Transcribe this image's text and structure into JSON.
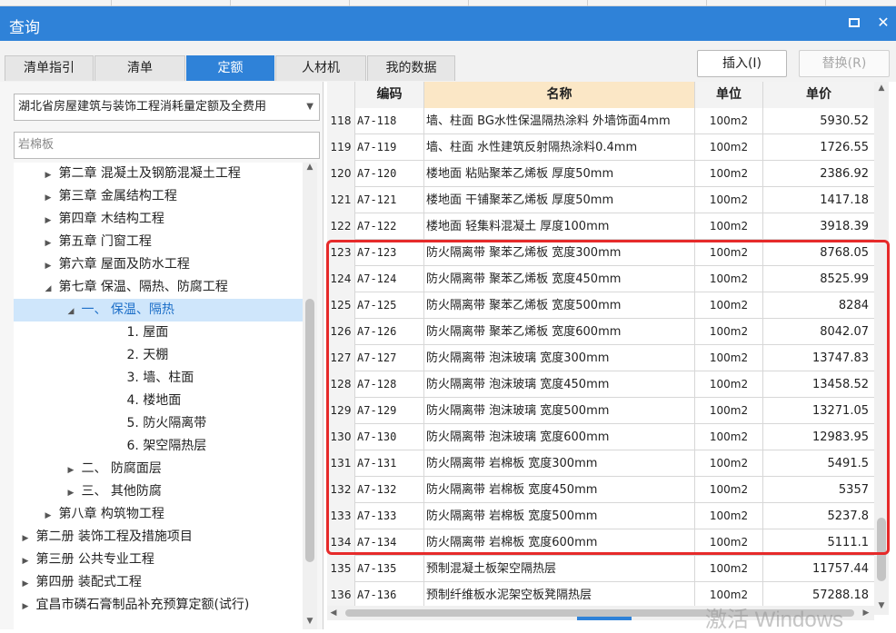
{
  "window": {
    "title": "查询",
    "restore_icon": "restore-icon",
    "close_icon": "close-icon"
  },
  "tabs": [
    {
      "label": "清单指引",
      "active": false
    },
    {
      "label": "清单",
      "active": false
    },
    {
      "label": "定额",
      "active": true
    },
    {
      "label": "人材机",
      "active": false
    },
    {
      "label": "我的数据",
      "active": false
    }
  ],
  "buttons": {
    "insert": "插入(I)",
    "replace": "替换(R)"
  },
  "left": {
    "quota_book": "湖北省房屋建筑与装饰工程消耗量定额及全费用",
    "search_value": "岩棉板",
    "tree": [
      {
        "label": "第二章 混凝土及钢筋混凝土工程",
        "indent": 1,
        "arrow": "▶"
      },
      {
        "label": "第三章 金属结构工程",
        "indent": 1,
        "arrow": "▶"
      },
      {
        "label": "第四章 木结构工程",
        "indent": 1,
        "arrow": "▶"
      },
      {
        "label": "第五章 门窗工程",
        "indent": 1,
        "arrow": "▶"
      },
      {
        "label": "第六章 屋面及防水工程",
        "indent": 1,
        "arrow": "▶"
      },
      {
        "label": "第七章 保温、隔热、防腐工程",
        "indent": 1,
        "arrow": "◢"
      },
      {
        "label": "一、 保温、隔热",
        "indent": 2,
        "arrow": "◢",
        "selected": true
      },
      {
        "label": "1. 屋面",
        "indent": 4,
        "arrow": ""
      },
      {
        "label": "2. 天棚",
        "indent": 4,
        "arrow": ""
      },
      {
        "label": "3. 墙、柱面",
        "indent": 4,
        "arrow": ""
      },
      {
        "label": "4. 楼地面",
        "indent": 4,
        "arrow": ""
      },
      {
        "label": "5. 防火隔离带",
        "indent": 4,
        "arrow": ""
      },
      {
        "label": "6. 架空隔热层",
        "indent": 4,
        "arrow": ""
      },
      {
        "label": "二、 防腐面层",
        "indent": 2,
        "arrow": "▶"
      },
      {
        "label": "三、 其他防腐",
        "indent": 2,
        "arrow": "▶"
      },
      {
        "label": "第八章 构筑物工程",
        "indent": 1,
        "arrow": "▶"
      },
      {
        "label": "第二册 装饰工程及措施项目",
        "indent": 0,
        "arrow": "▶"
      },
      {
        "label": "第三册 公共专业工程",
        "indent": 0,
        "arrow": "▶"
      },
      {
        "label": "第四册 装配式工程",
        "indent": 0,
        "arrow": "▶"
      },
      {
        "label": "宜昌市磷石膏制品补充预算定额(试行)",
        "indent": 0,
        "arrow": "▶"
      }
    ]
  },
  "table": {
    "headers": {
      "code": "编码",
      "name": "名称",
      "unit": "单位",
      "price": "单价"
    },
    "rows": [
      {
        "idx": "118",
        "code": "A7-118",
        "name": "墙、柱面 BG水性保温隔热涂料 外墙饰面4mm",
        "unit": "100m2",
        "price": "5930.52"
      },
      {
        "idx": "119",
        "code": "A7-119",
        "name": "墙、柱面 水性建筑反射隔热涂料0.4mm",
        "unit": "100m2",
        "price": "1726.55"
      },
      {
        "idx": "120",
        "code": "A7-120",
        "name": "楼地面 粘贴聚苯乙烯板 厚度50mm",
        "unit": "100m2",
        "price": "2386.92"
      },
      {
        "idx": "121",
        "code": "A7-121",
        "name": "楼地面 干铺聚苯乙烯板 厚度50mm",
        "unit": "100m2",
        "price": "1417.18"
      },
      {
        "idx": "122",
        "code": "A7-122",
        "name": "楼地面 轻集料混凝土 厚度100mm",
        "unit": "100m2",
        "price": "3918.39"
      },
      {
        "idx": "123",
        "code": "A7-123",
        "name": "防火隔离带 聚苯乙烯板 宽度300mm",
        "unit": "100m2",
        "price": "8768.05"
      },
      {
        "idx": "124",
        "code": "A7-124",
        "name": "防火隔离带 聚苯乙烯板 宽度450mm",
        "unit": "100m2",
        "price": "8525.99"
      },
      {
        "idx": "125",
        "code": "A7-125",
        "name": "防火隔离带 聚苯乙烯板 宽度500mm",
        "unit": "100m2",
        "price": "8284"
      },
      {
        "idx": "126",
        "code": "A7-126",
        "name": "防火隔离带 聚苯乙烯板 宽度600mm",
        "unit": "100m2",
        "price": "8042.07"
      },
      {
        "idx": "127",
        "code": "A7-127",
        "name": "防火隔离带 泡沫玻璃 宽度300mm",
        "unit": "100m2",
        "price": "13747.83"
      },
      {
        "idx": "128",
        "code": "A7-128",
        "name": "防火隔离带 泡沫玻璃 宽度450mm",
        "unit": "100m2",
        "price": "13458.52"
      },
      {
        "idx": "129",
        "code": "A7-129",
        "name": "防火隔离带 泡沫玻璃 宽度500mm",
        "unit": "100m2",
        "price": "13271.05"
      },
      {
        "idx": "130",
        "code": "A7-130",
        "name": "防火隔离带 泡沫玻璃 宽度600mm",
        "unit": "100m2",
        "price": "12983.95"
      },
      {
        "idx": "131",
        "code": "A7-131",
        "name": "防火隔离带 岩棉板 宽度300mm",
        "unit": "100m2",
        "price": "5491.5"
      },
      {
        "idx": "132",
        "code": "A7-132",
        "name": "防火隔离带 岩棉板 宽度450mm",
        "unit": "100m2",
        "price": "5357"
      },
      {
        "idx": "133",
        "code": "A7-133",
        "name": "防火隔离带 岩棉板 宽度500mm",
        "unit": "100m2",
        "price": "5237.8"
      },
      {
        "idx": "134",
        "code": "A7-134",
        "name": "防火隔离带 岩棉板 宽度600mm",
        "unit": "100m2",
        "price": "5111.1"
      },
      {
        "idx": "135",
        "code": "A7-135",
        "name": "预制混凝土板架空隔热层",
        "unit": "100m2",
        "price": "11757.44"
      },
      {
        "idx": "136",
        "code": "A7-136",
        "name": "预制纤维板水泥架空板凳隔热层",
        "unit": "100m2",
        "price": "57288.18"
      }
    ]
  },
  "watermark": "激活 Windows",
  "colors": {
    "accent": "#2f82d8",
    "highlight": "#e62a2a",
    "header_name_bg": "#fbe7c6"
  }
}
